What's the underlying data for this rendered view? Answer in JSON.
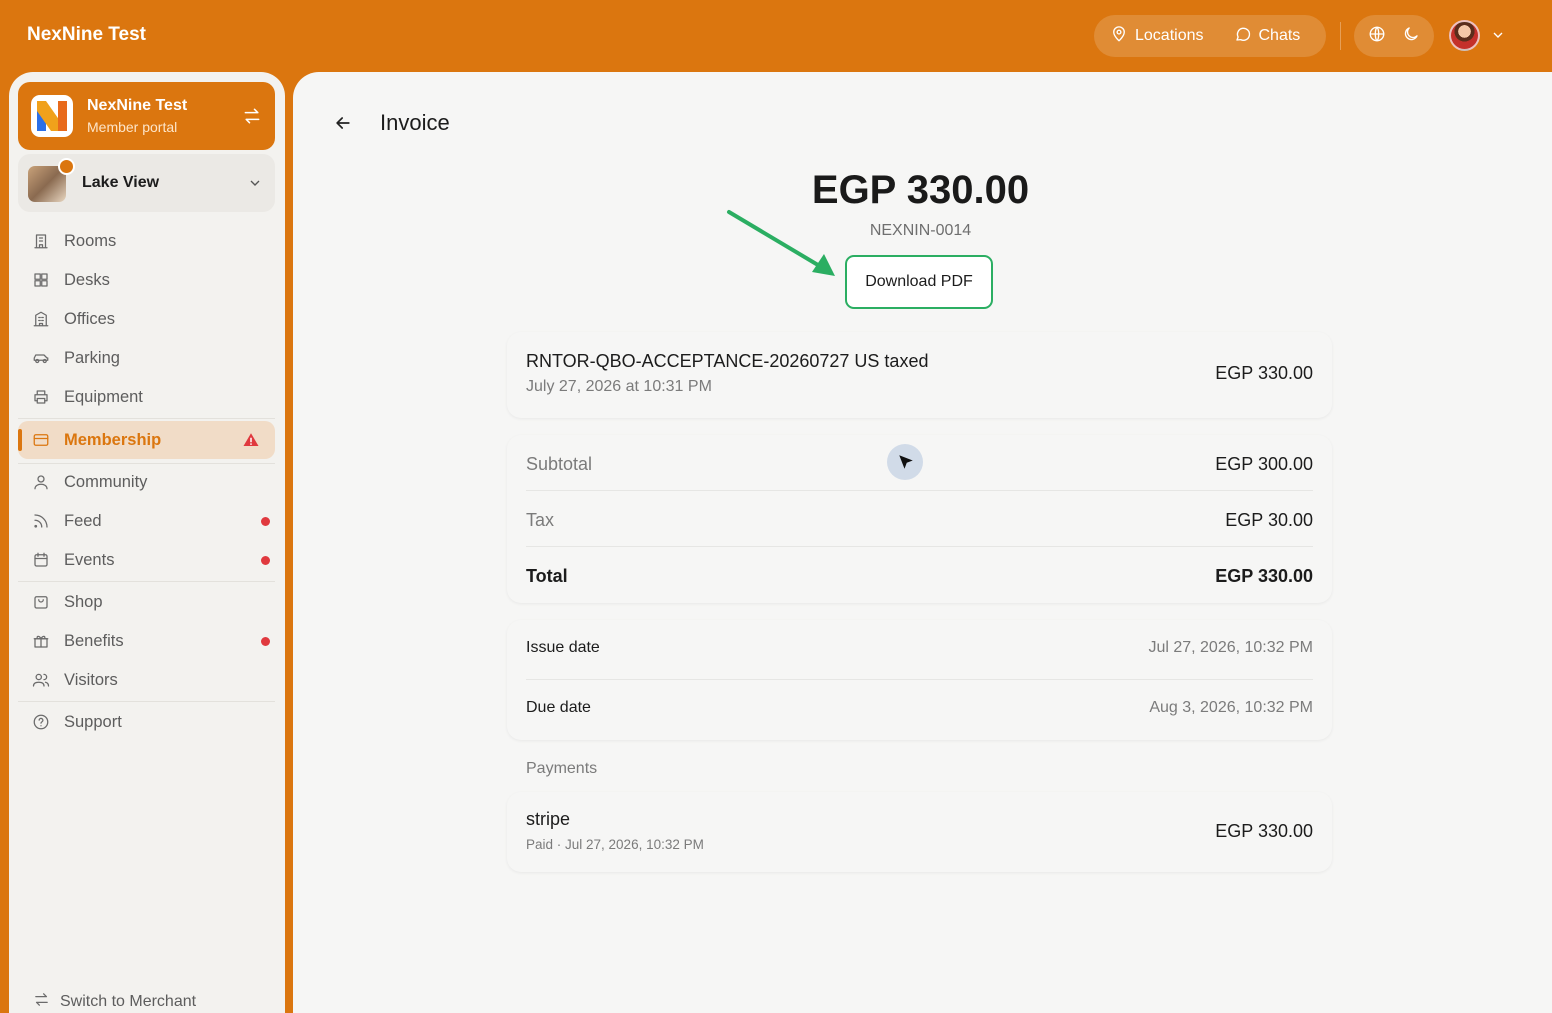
{
  "app": {
    "title": "NexNine Test"
  },
  "topbar": {
    "nav": [
      {
        "label": "Locations",
        "icon": "map-pin-icon"
      },
      {
        "label": "Chats",
        "icon": "chat-bubble-icon"
      }
    ],
    "tools": [
      {
        "icon": "globe-icon"
      },
      {
        "icon": "moon-icon"
      }
    ]
  },
  "sidebar": {
    "org": {
      "name": "NexNine Test",
      "subtitle": "Member portal"
    },
    "location": {
      "name": "Lake View"
    },
    "items": [
      {
        "label": "Rooms",
        "icon": "building-icon"
      },
      {
        "label": "Desks",
        "icon": "grid-icon"
      },
      {
        "label": "Offices",
        "icon": "office-building-icon"
      },
      {
        "label": "Parking",
        "icon": "car-icon"
      },
      {
        "label": "Equipment",
        "icon": "printer-icon"
      },
      {
        "label": "Membership",
        "icon": "credit-card-icon",
        "active": true,
        "warning": true
      },
      {
        "label": "Community",
        "icon": "user-icon"
      },
      {
        "label": "Feed",
        "icon": "rss-icon",
        "dot": true
      },
      {
        "label": "Events",
        "icon": "calendar-icon",
        "dot": true
      },
      {
        "label": "Shop",
        "icon": "shopping-bag-icon"
      },
      {
        "label": "Benefits",
        "icon": "gift-icon",
        "dot": true
      },
      {
        "label": "Visitors",
        "icon": "users-icon"
      },
      {
        "label": "Support",
        "icon": "help-circle-icon"
      }
    ],
    "switch_label": "Switch to Merchant"
  },
  "invoice": {
    "page_title": "Invoice",
    "amount": "EGP 330.00",
    "number": "NEXNIN-0014",
    "download_label": "Download PDF",
    "line_item": {
      "description": "RNTOR-QBO-ACCEPTANCE-20260727 US taxed",
      "date": "July 27, 2026 at 10:31 PM",
      "amount": "EGP 330.00"
    },
    "totals": [
      {
        "label": "Subtotal",
        "value": "EGP 300.00"
      },
      {
        "label": "Tax",
        "value": "EGP 30.00"
      },
      {
        "label": "Total",
        "value": "EGP 330.00"
      }
    ],
    "dates": [
      {
        "label": "Issue date",
        "value": "Jul 27, 2026, 10:32 PM"
      },
      {
        "label": "Due date",
        "value": "Aug 3, 2026, 10:32 PM"
      }
    ],
    "payments_label": "Payments",
    "payment": {
      "method": "stripe",
      "status": "Paid · Jul 27, 2026, 10:32 PM",
      "amount": "EGP 330.00"
    }
  },
  "colors": {
    "brand": "#db760f",
    "annotation": "#2bae62",
    "alert": "#e0393e"
  }
}
